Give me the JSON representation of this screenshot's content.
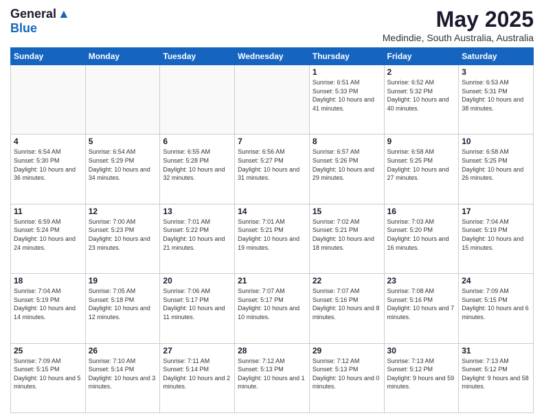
{
  "logo": {
    "general": "General",
    "blue": "Blue"
  },
  "title": {
    "month": "May 2025",
    "location": "Medindie, South Australia, Australia"
  },
  "weekdays": [
    "Sunday",
    "Monday",
    "Tuesday",
    "Wednesday",
    "Thursday",
    "Friday",
    "Saturday"
  ],
  "weeks": [
    [
      {
        "day": "",
        "sunrise": "",
        "sunset": "",
        "daylight": ""
      },
      {
        "day": "",
        "sunrise": "",
        "sunset": "",
        "daylight": ""
      },
      {
        "day": "",
        "sunrise": "",
        "sunset": "",
        "daylight": ""
      },
      {
        "day": "",
        "sunrise": "",
        "sunset": "",
        "daylight": ""
      },
      {
        "day": "1",
        "sunrise": "Sunrise: 6:51 AM",
        "sunset": "Sunset: 5:33 PM",
        "daylight": "Daylight: 10 hours and 41 minutes."
      },
      {
        "day": "2",
        "sunrise": "Sunrise: 6:52 AM",
        "sunset": "Sunset: 5:32 PM",
        "daylight": "Daylight: 10 hours and 40 minutes."
      },
      {
        "day": "3",
        "sunrise": "Sunrise: 6:53 AM",
        "sunset": "Sunset: 5:31 PM",
        "daylight": "Daylight: 10 hours and 38 minutes."
      }
    ],
    [
      {
        "day": "4",
        "sunrise": "Sunrise: 6:54 AM",
        "sunset": "Sunset: 5:30 PM",
        "daylight": "Daylight: 10 hours and 36 minutes."
      },
      {
        "day": "5",
        "sunrise": "Sunrise: 6:54 AM",
        "sunset": "Sunset: 5:29 PM",
        "daylight": "Daylight: 10 hours and 34 minutes."
      },
      {
        "day": "6",
        "sunrise": "Sunrise: 6:55 AM",
        "sunset": "Sunset: 5:28 PM",
        "daylight": "Daylight: 10 hours and 32 minutes."
      },
      {
        "day": "7",
        "sunrise": "Sunrise: 6:56 AM",
        "sunset": "Sunset: 5:27 PM",
        "daylight": "Daylight: 10 hours and 31 minutes."
      },
      {
        "day": "8",
        "sunrise": "Sunrise: 6:57 AM",
        "sunset": "Sunset: 5:26 PM",
        "daylight": "Daylight: 10 hours and 29 minutes."
      },
      {
        "day": "9",
        "sunrise": "Sunrise: 6:58 AM",
        "sunset": "Sunset: 5:25 PM",
        "daylight": "Daylight: 10 hours and 27 minutes."
      },
      {
        "day": "10",
        "sunrise": "Sunrise: 6:58 AM",
        "sunset": "Sunset: 5:25 PM",
        "daylight": "Daylight: 10 hours and 26 minutes."
      }
    ],
    [
      {
        "day": "11",
        "sunrise": "Sunrise: 6:59 AM",
        "sunset": "Sunset: 5:24 PM",
        "daylight": "Daylight: 10 hours and 24 minutes."
      },
      {
        "day": "12",
        "sunrise": "Sunrise: 7:00 AM",
        "sunset": "Sunset: 5:23 PM",
        "daylight": "Daylight: 10 hours and 23 minutes."
      },
      {
        "day": "13",
        "sunrise": "Sunrise: 7:01 AM",
        "sunset": "Sunset: 5:22 PM",
        "daylight": "Daylight: 10 hours and 21 minutes."
      },
      {
        "day": "14",
        "sunrise": "Sunrise: 7:01 AM",
        "sunset": "Sunset: 5:21 PM",
        "daylight": "Daylight: 10 hours and 19 minutes."
      },
      {
        "day": "15",
        "sunrise": "Sunrise: 7:02 AM",
        "sunset": "Sunset: 5:21 PM",
        "daylight": "Daylight: 10 hours and 18 minutes."
      },
      {
        "day": "16",
        "sunrise": "Sunrise: 7:03 AM",
        "sunset": "Sunset: 5:20 PM",
        "daylight": "Daylight: 10 hours and 16 minutes."
      },
      {
        "day": "17",
        "sunrise": "Sunrise: 7:04 AM",
        "sunset": "Sunset: 5:19 PM",
        "daylight": "Daylight: 10 hours and 15 minutes."
      }
    ],
    [
      {
        "day": "18",
        "sunrise": "Sunrise: 7:04 AM",
        "sunset": "Sunset: 5:19 PM",
        "daylight": "Daylight: 10 hours and 14 minutes."
      },
      {
        "day": "19",
        "sunrise": "Sunrise: 7:05 AM",
        "sunset": "Sunset: 5:18 PM",
        "daylight": "Daylight: 10 hours and 12 minutes."
      },
      {
        "day": "20",
        "sunrise": "Sunrise: 7:06 AM",
        "sunset": "Sunset: 5:17 PM",
        "daylight": "Daylight: 10 hours and 11 minutes."
      },
      {
        "day": "21",
        "sunrise": "Sunrise: 7:07 AM",
        "sunset": "Sunset: 5:17 PM",
        "daylight": "Daylight: 10 hours and 10 minutes."
      },
      {
        "day": "22",
        "sunrise": "Sunrise: 7:07 AM",
        "sunset": "Sunset: 5:16 PM",
        "daylight": "Daylight: 10 hours and 8 minutes."
      },
      {
        "day": "23",
        "sunrise": "Sunrise: 7:08 AM",
        "sunset": "Sunset: 5:16 PM",
        "daylight": "Daylight: 10 hours and 7 minutes."
      },
      {
        "day": "24",
        "sunrise": "Sunrise: 7:09 AM",
        "sunset": "Sunset: 5:15 PM",
        "daylight": "Daylight: 10 hours and 6 minutes."
      }
    ],
    [
      {
        "day": "25",
        "sunrise": "Sunrise: 7:09 AM",
        "sunset": "Sunset: 5:15 PM",
        "daylight": "Daylight: 10 hours and 5 minutes."
      },
      {
        "day": "26",
        "sunrise": "Sunrise: 7:10 AM",
        "sunset": "Sunset: 5:14 PM",
        "daylight": "Daylight: 10 hours and 3 minutes."
      },
      {
        "day": "27",
        "sunrise": "Sunrise: 7:11 AM",
        "sunset": "Sunset: 5:14 PM",
        "daylight": "Daylight: 10 hours and 2 minutes."
      },
      {
        "day": "28",
        "sunrise": "Sunrise: 7:12 AM",
        "sunset": "Sunset: 5:13 PM",
        "daylight": "Daylight: 10 hours and 1 minute."
      },
      {
        "day": "29",
        "sunrise": "Sunrise: 7:12 AM",
        "sunset": "Sunset: 5:13 PM",
        "daylight": "Daylight: 10 hours and 0 minutes."
      },
      {
        "day": "30",
        "sunrise": "Sunrise: 7:13 AM",
        "sunset": "Sunset: 5:12 PM",
        "daylight": "Daylight: 9 hours and 59 minutes."
      },
      {
        "day": "31",
        "sunrise": "Sunrise: 7:13 AM",
        "sunset": "Sunset: 5:12 PM",
        "daylight": "Daylight: 9 hours and 58 minutes."
      }
    ]
  ]
}
